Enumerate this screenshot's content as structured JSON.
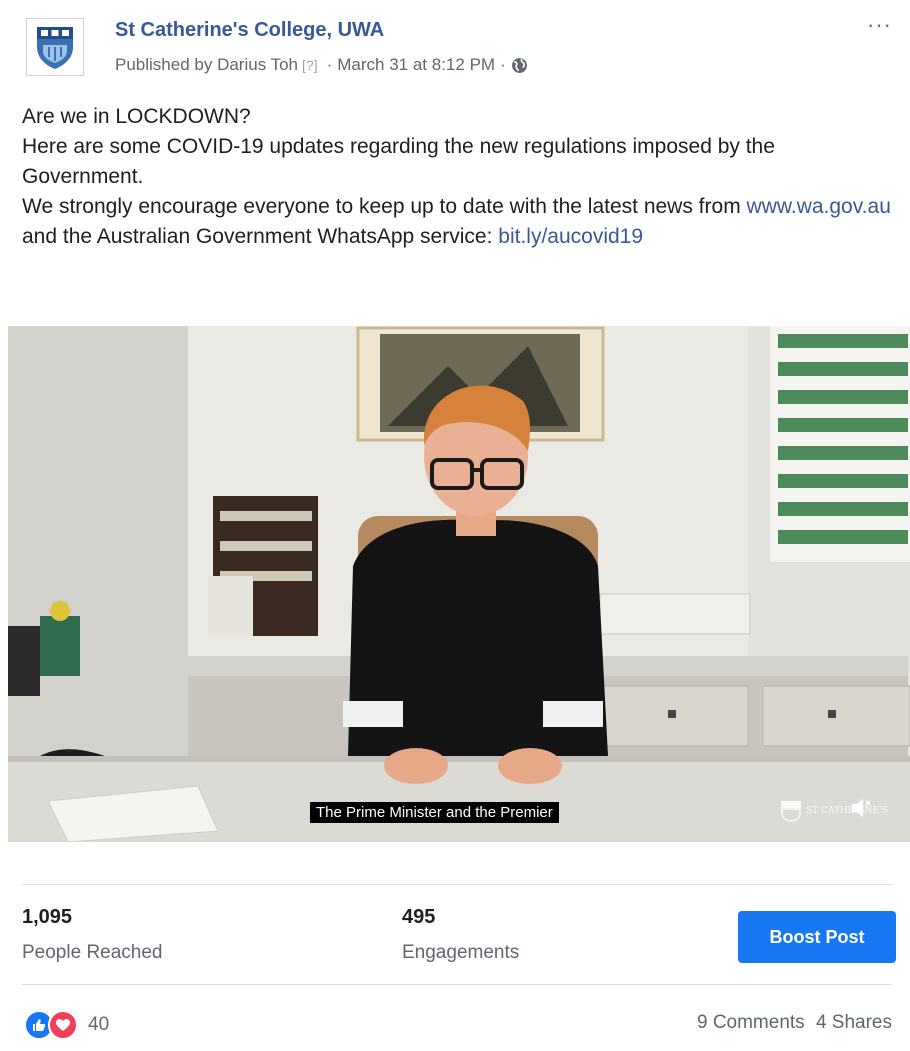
{
  "post": {
    "page_name": "St Catherine's College, UWA",
    "published_by": "Published by Darius Toh",
    "help_marker": "[?]",
    "date": "March 31 at 8:12 PM",
    "more_label": "···",
    "text_line1": "Are we in LOCKDOWN?",
    "text_line2": "Here are some COVID-19 updates regarding the new regulations imposed by the Government.",
    "text_line3_start": "We strongly encourage everyone to keep up to date with the latest news from",
    "link1": "www.wa.gov.au",
    "text_line3_mid": "and the Australian Government WhatsApp service:",
    "link2": "bit.ly/aucovid19"
  },
  "video": {
    "caption": "The Prime Minister and the Premier",
    "watermark": "ST CATHERINE'S",
    "volume_icon": "volume-muted-icon"
  },
  "insights": {
    "reach_value": "1,095",
    "reach_label": "People Reached",
    "engagement_value": "495",
    "engagement_label": "Engagements",
    "boost_label": "Boost Post"
  },
  "engagement": {
    "reaction_count": "40",
    "comments": "9 Comments",
    "shares": "4 Shares"
  },
  "colors": {
    "link": "#385898",
    "boost_button": "#1877f2",
    "like": "#1877f2",
    "love": "#f33e58"
  }
}
